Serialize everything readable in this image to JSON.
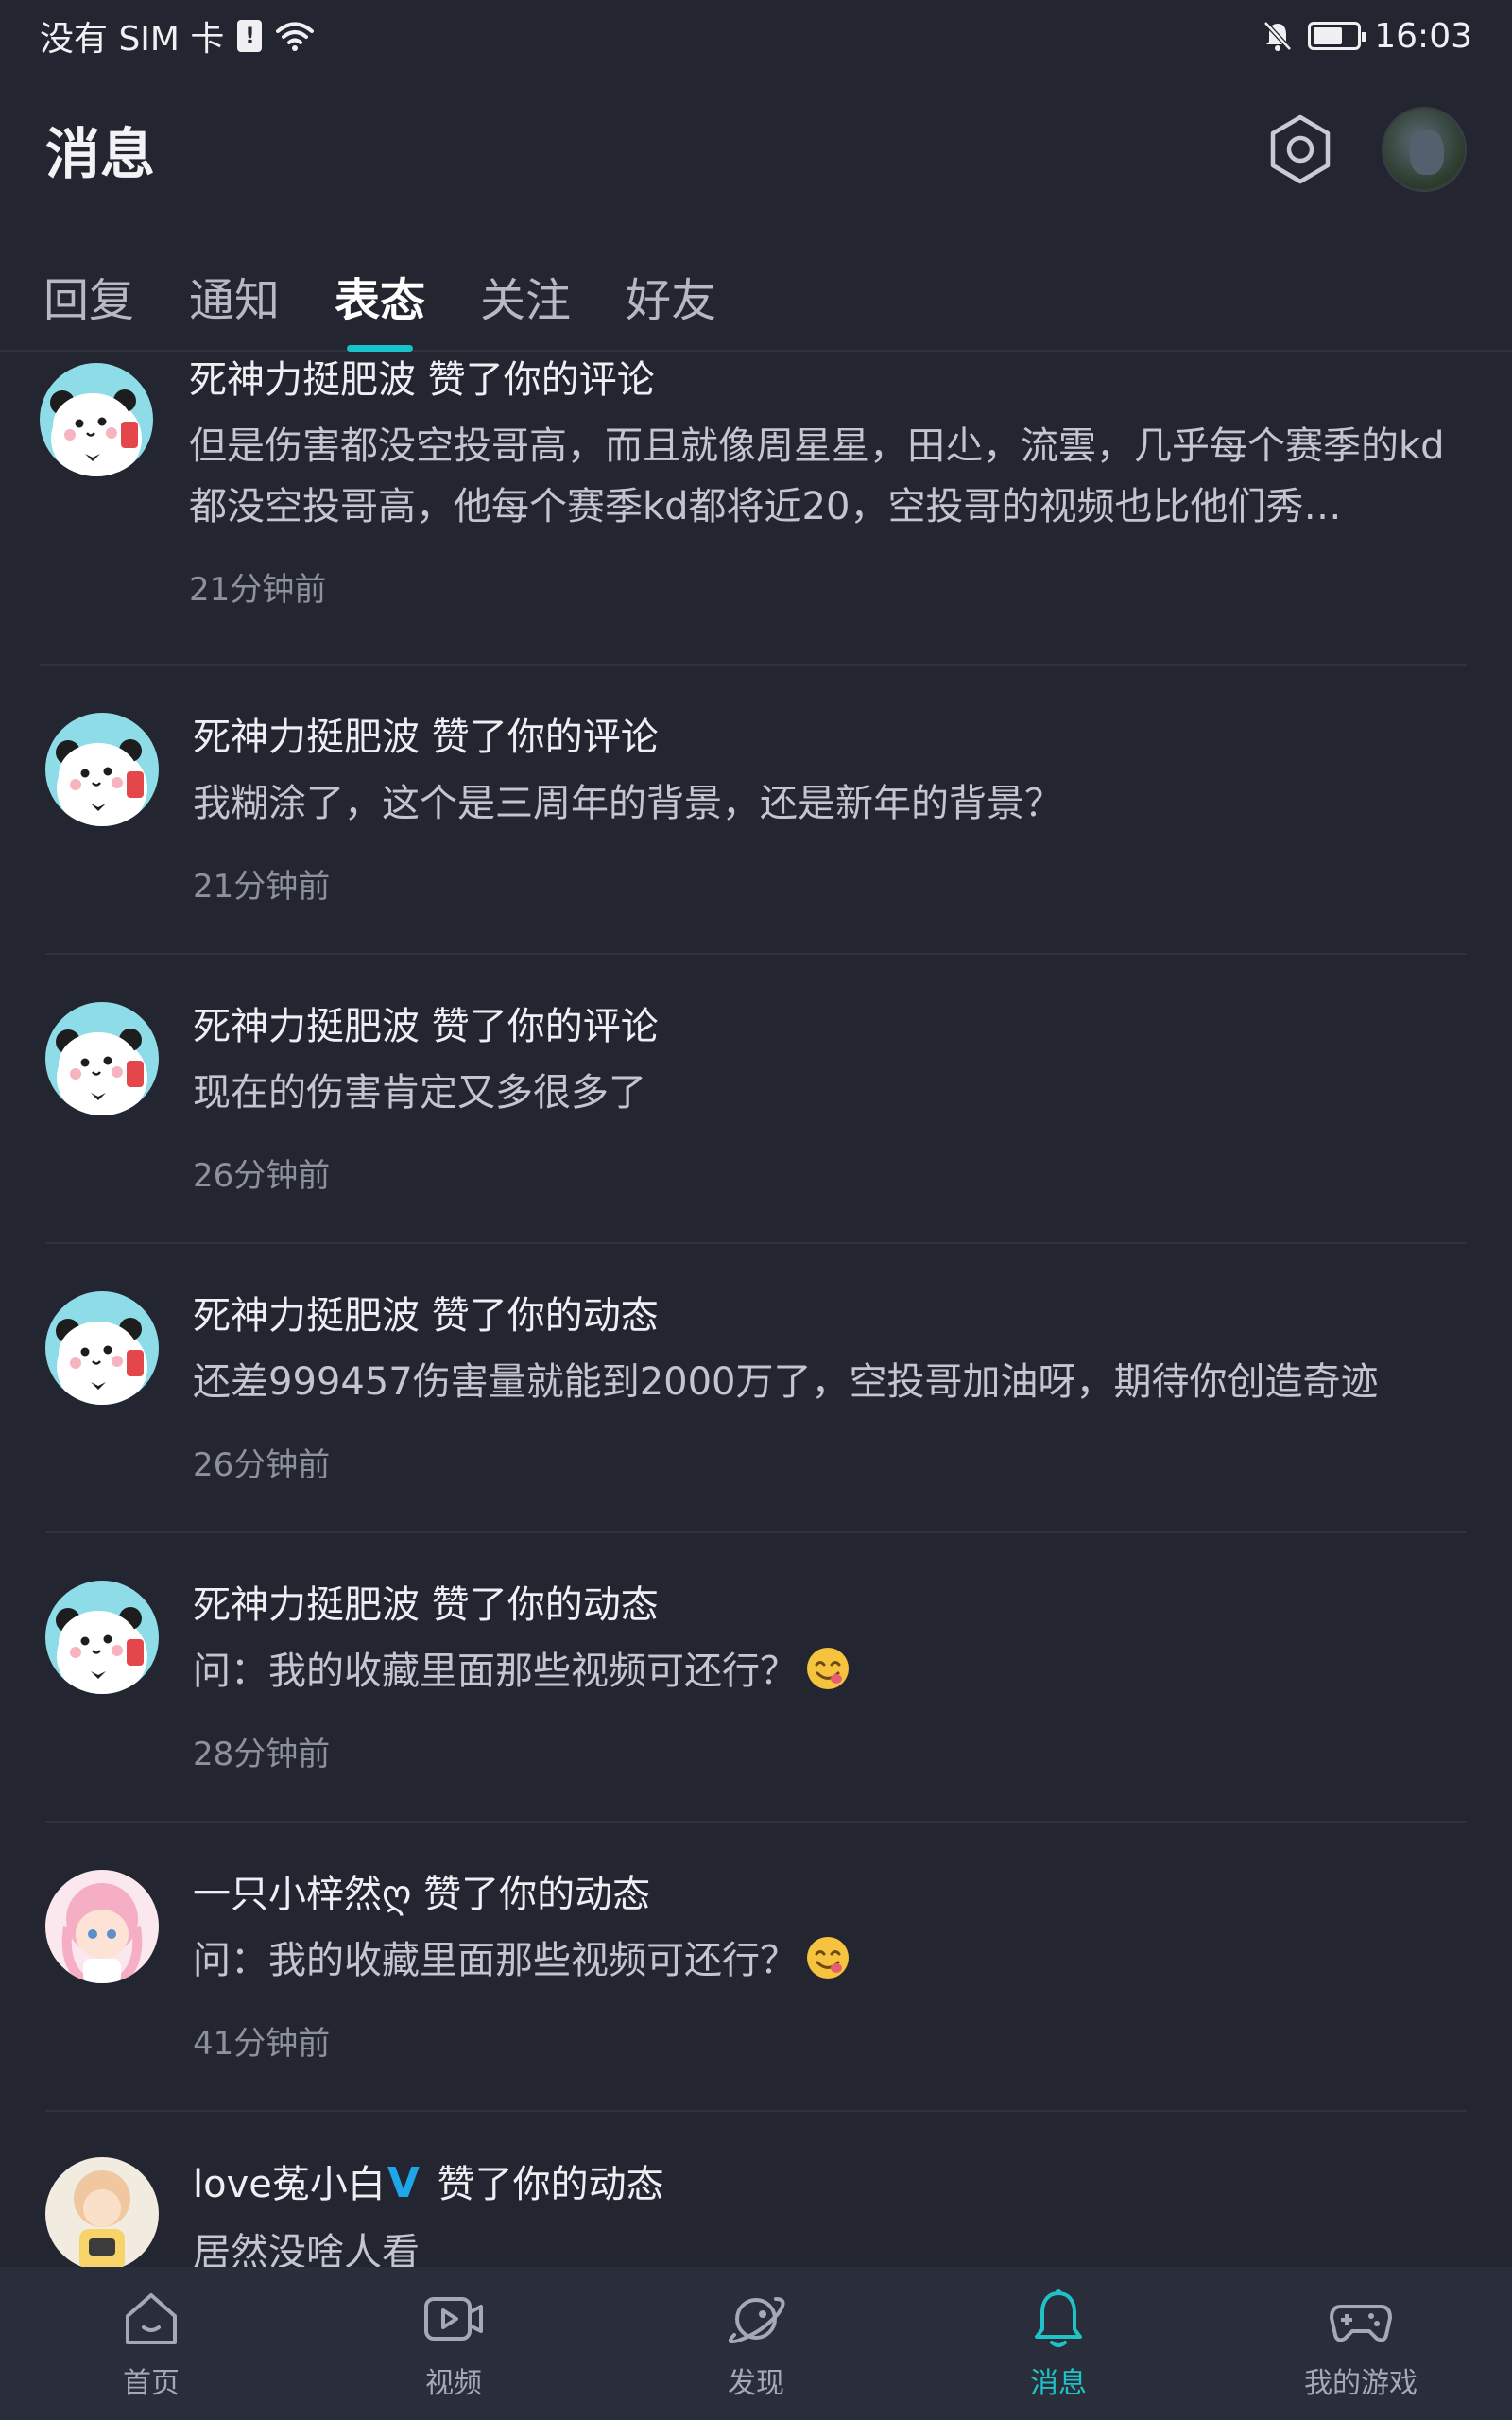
{
  "status_bar": {
    "carrier": "没有 SIM 卡",
    "sim_alert": "!",
    "time": "16:03"
  },
  "header": {
    "title": "消息"
  },
  "tabs": [
    {
      "label": "回复",
      "active": false
    },
    {
      "label": "通知",
      "active": false
    },
    {
      "label": "表态",
      "active": true
    },
    {
      "label": "关注",
      "active": false
    },
    {
      "label": "好友",
      "active": false
    }
  ],
  "messages": [
    {
      "user": "死神力挺肥波",
      "action": "赞了你的评论",
      "body": "但是伤害都没空投哥高，而且就像周星星，田尐，流雲，几乎每个赛季的kd都没空投哥高，他每个赛季kd都将近20，空投哥的视频也比他们秀…",
      "time": "21分钟前"
    },
    {
      "user": "死神力挺肥波",
      "action": "赞了你的评论",
      "body": "我糊涂了，这个是三周年的背景，还是新年的背景？",
      "time": "21分钟前"
    },
    {
      "user": "死神力挺肥波",
      "action": "赞了你的评论",
      "body": "现在的伤害肯定又多很多了",
      "time": "26分钟前"
    },
    {
      "user": "死神力挺肥波",
      "action": "赞了你的动态",
      "body": "还差999457伤害量就能到2000万了，空投哥加油呀，期待你创造奇迹",
      "time": "26分钟前"
    },
    {
      "user": "死神力挺肥波",
      "action": "赞了你的动态",
      "body": "问：我的收藏里面那些视频可还行？",
      "emoji": "yum-emoji",
      "time": "28分钟前"
    },
    {
      "user": "一只小梓然ღ",
      "action": "赞了你的动态",
      "body": "问：我的收藏里面那些视频可还行？",
      "emoji": "yum-emoji",
      "time": "41分钟前"
    },
    {
      "user": "love菟小白",
      "verified_mark": "V",
      "action": "赞了你的动态",
      "body": "居然没啥人看"
    }
  ],
  "bottom_nav": [
    {
      "label": "首页",
      "icon": "home-icon",
      "active": false
    },
    {
      "label": "视频",
      "icon": "video-icon",
      "active": false
    },
    {
      "label": "发现",
      "icon": "planet-icon",
      "active": false
    },
    {
      "label": "消息",
      "icon": "bell-icon",
      "active": true
    },
    {
      "label": "我的游戏",
      "icon": "gamepad-icon",
      "active": false
    }
  ],
  "colors": {
    "background": "#232530",
    "accent": "#1fc2c6",
    "nav_background": "#2a2d3a",
    "verified": "#1ea7e8"
  }
}
